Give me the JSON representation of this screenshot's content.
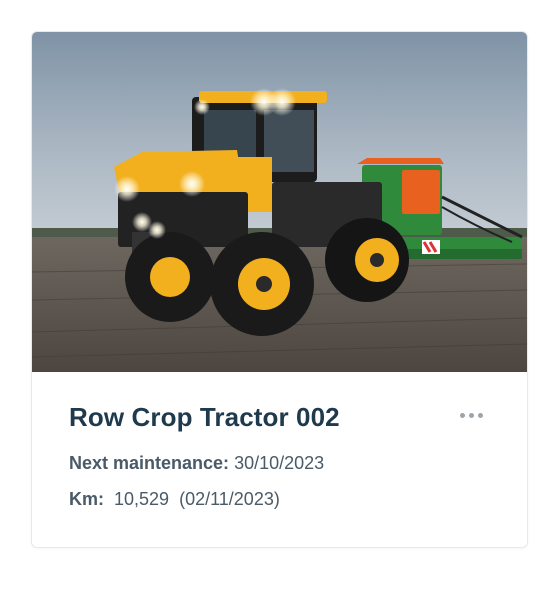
{
  "card": {
    "image_alt": "JCB Fastrac tractor pulling a seed drill in a field",
    "title": "Row Crop Tractor 002",
    "menu_icon": "more-horizontal-icon",
    "maintenance": {
      "label": "Next maintenance:",
      "value": "30/10/2023"
    },
    "km": {
      "label": "Km:",
      "value": "10,529",
      "date": "(02/11/2023)"
    }
  },
  "colors": {
    "title": "#1f3a4d",
    "text": "#4a5a67",
    "tractor_yellow": "#f2b01e",
    "implement_green": "#2f8a3c",
    "implement_orange": "#e8611e"
  }
}
